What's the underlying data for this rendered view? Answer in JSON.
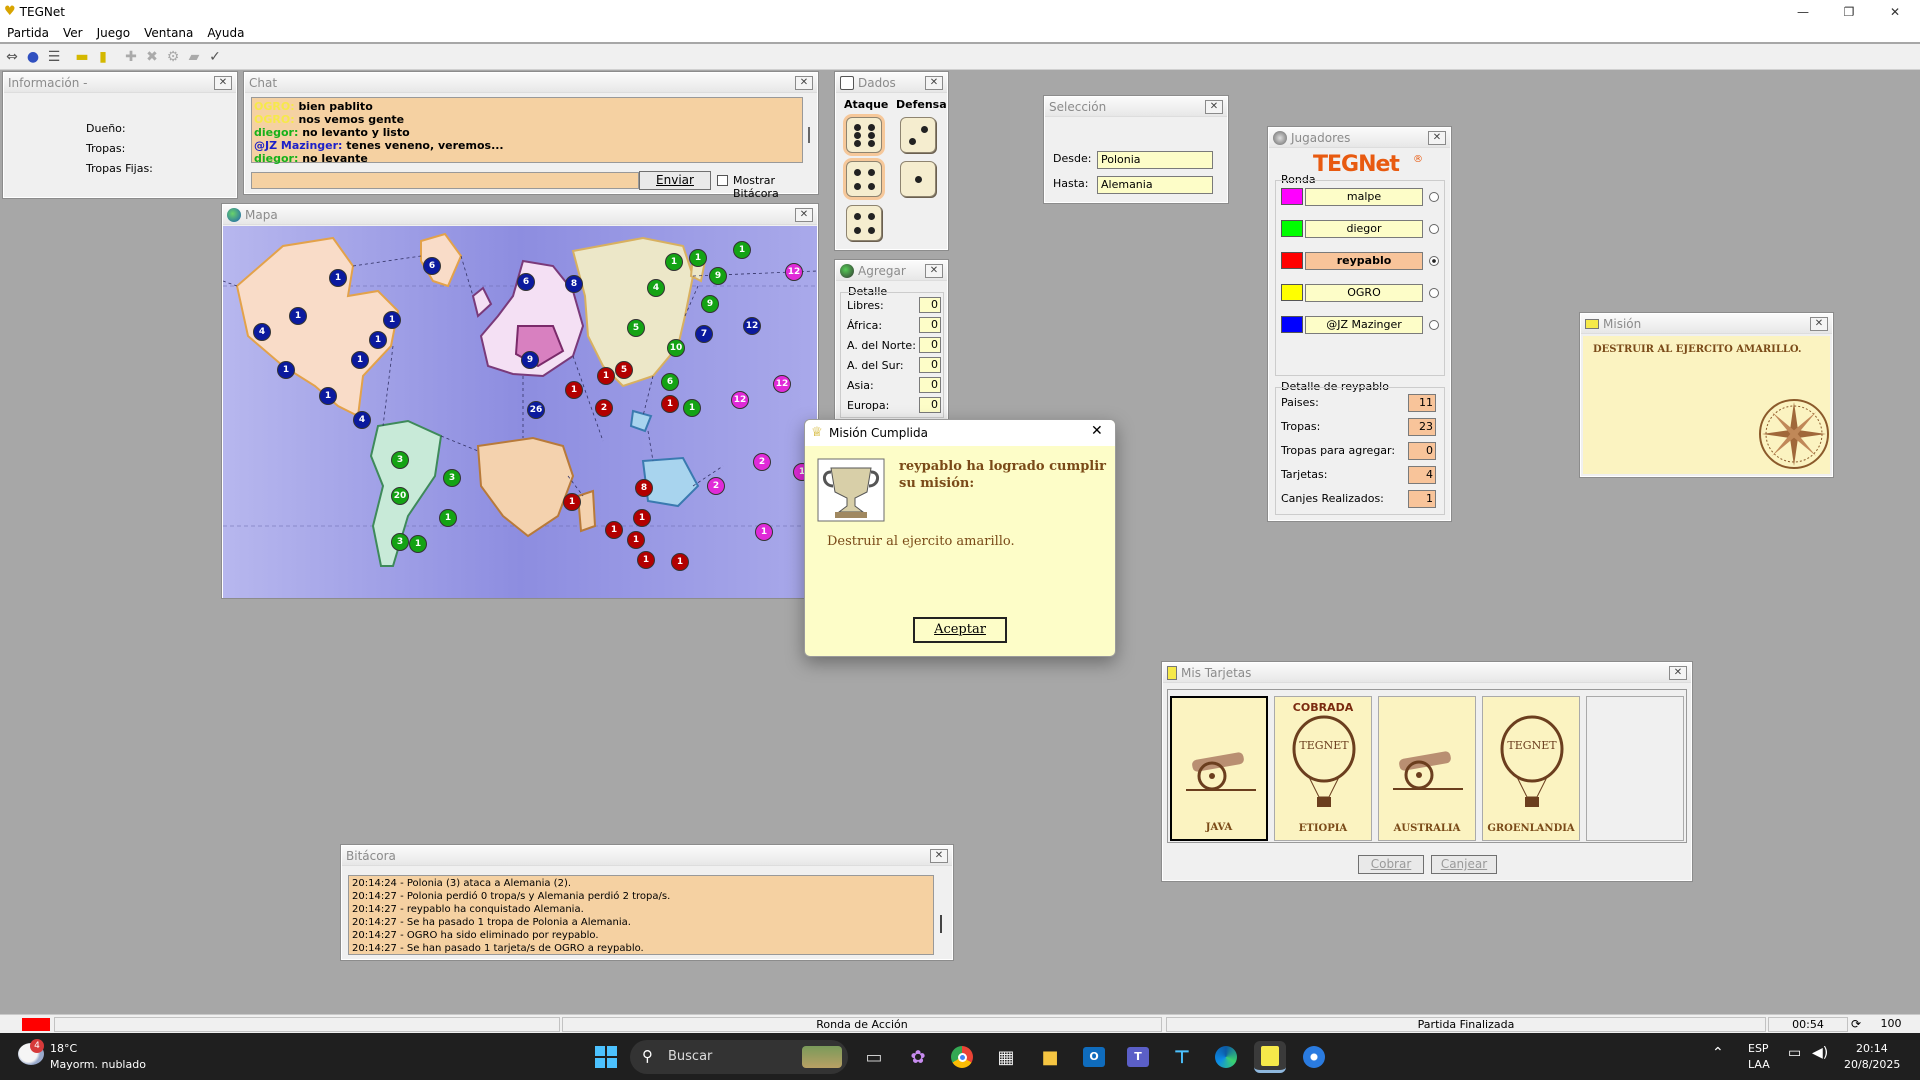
{
  "app": {
    "title": "TEGNet"
  },
  "menu": [
    "Partida",
    "Ver",
    "Juego",
    "Ventana",
    "Ayuda"
  ],
  "info": {
    "title": "Información -",
    "owner_label": "Dueño:",
    "troops_label": "Tropas:",
    "fixed_troops_label": "Tropas Fijas:"
  },
  "chat": {
    "title": "Chat",
    "messages": [
      {
        "user": "OGRO:",
        "text": "bien pablito",
        "color": "#f6e94a"
      },
      {
        "user": "OGRO:",
        "text": "nos vemos gente",
        "color": "#f6e94a"
      },
      {
        "user": "diegor:",
        "text": "no levanto y listo",
        "color": "#16b11a"
      },
      {
        "user": "@JZ Mazinger:",
        "text": "tenes veneno, veremos...",
        "color": "#1d20c8"
      },
      {
        "user": "diegor:",
        "text": "no levante",
        "color": "#16b11a"
      }
    ],
    "send_label": "Enviar",
    "show_log_label": "Mostrar Bitácora"
  },
  "dice": {
    "title": "Dados",
    "attack_label": "Ataque",
    "defense_label": "Defensa"
  },
  "add": {
    "title": "Agregar",
    "detail_label": "Detalle",
    "rows": [
      {
        "label": "Libres:",
        "value": "0"
      },
      {
        "label": "África:",
        "value": "0"
      },
      {
        "label": "A. del Norte:",
        "value": "0"
      },
      {
        "label": "A. del Sur:",
        "value": "0"
      },
      {
        "label": "Asia:",
        "value": "0"
      },
      {
        "label": "Europa:",
        "value": "0"
      }
    ]
  },
  "selection": {
    "title": "Selección",
    "from_label": "Desde:",
    "from_value": "Polonia",
    "to_label": "Hasta:",
    "to_value": "Alemania"
  },
  "players": {
    "title": "Jugadores",
    "logo": "TEGNet",
    "round_label": "Ronda",
    "list": [
      {
        "name": "malpe",
        "color": "#ff00ff",
        "active": false
      },
      {
        "name": "diegor",
        "color": "#00ff00",
        "active": false
      },
      {
        "name": "reypablo",
        "color": "#ff0000",
        "active": true
      },
      {
        "name": "OGRO",
        "color": "#ffff00",
        "active": false
      },
      {
        "name": "@JZ Mazinger",
        "color": "#0000ff",
        "active": false
      }
    ],
    "detail_title": "Detalle de reypablo",
    "stats": [
      {
        "label": "Paises:",
        "value": "11"
      },
      {
        "label": "Tropas:",
        "value": "23"
      },
      {
        "label": "Tropas para agregar:",
        "value": "0"
      },
      {
        "label": "Tarjetas:",
        "value": "4"
      },
      {
        "label": "Canjes Realizados:",
        "value": "1"
      }
    ]
  },
  "mission": {
    "title": "Misión",
    "text": "DESTRUIR AL EJERCITO AMARILLO."
  },
  "map": {
    "title": "Mapa"
  },
  "dialog": {
    "title": "Misión Cumplida",
    "heading": "reypablo ha logrado cumplir su misión:",
    "body": "Destruir al ejercito amarillo.",
    "ok_label": "Aceptar"
  },
  "cards": {
    "title": "Mis Tarjetas",
    "items": [
      {
        "name": "JAVA",
        "badge": "",
        "type": "cannon"
      },
      {
        "name": "ETIOPIA",
        "badge": "COBRADA",
        "type": "balloon"
      },
      {
        "name": "AUSTRALIA",
        "badge": "",
        "type": "cannon"
      },
      {
        "name": "GROENLANDIA",
        "badge": "",
        "type": "balloon"
      }
    ],
    "collect_label": "Cobrar",
    "swap_label": "Canjear"
  },
  "log": {
    "title": "Bitácora",
    "lines": [
      "20:14:24 - Polonia (3) ataca a Alemania (2).",
      "20:14:27 - Polonia perdió 0 tropa/s y Alemania perdió 2 tropa/s.",
      "20:14:27 - reypablo ha conquistado Alemania.",
      "20:14:27 - Se ha pasado 1 tropa de Polonia a Alemania.",
      "20:14:27 - OGRO ha sido eliminado por reypablo.",
      "20:14:27 - Se han pasado 1 tarjeta/s de OGRO a reypablo."
    ]
  },
  "status": {
    "round": "Ronda de Acción",
    "game": "Partida Finalizada",
    "time": "00:54",
    "value": "100"
  },
  "taskbar": {
    "weather_temp": "18°C",
    "weather_desc": "Mayorm. nublado",
    "weather_badge": "4",
    "search_placeholder": "Buscar",
    "lang1": "ESP",
    "lang2": "LAA",
    "clock_time": "20:14",
    "clock_date": "20/8/2025"
  }
}
